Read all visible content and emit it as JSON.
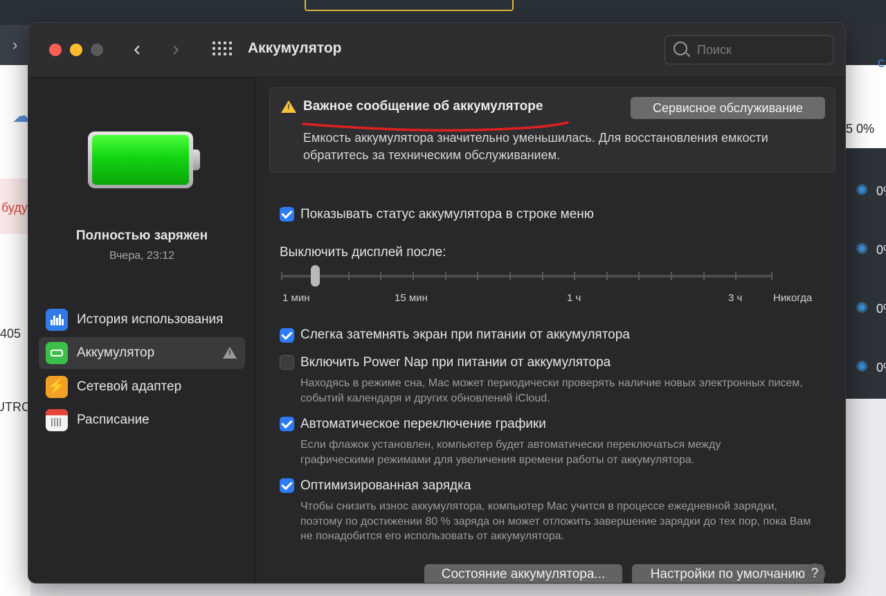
{
  "window": {
    "title": "Аккумулятор",
    "search_placeholder": "Поиск"
  },
  "sidebar": {
    "status_title": "Полностью заряжен",
    "status_time": "Вчера, 23:12",
    "items": [
      {
        "label": "История использования",
        "icon": "bar-chart-icon"
      },
      {
        "label": "Аккумулятор",
        "icon": "battery-icon",
        "active": true,
        "warning": true
      },
      {
        "label": "Сетевой адаптер",
        "icon": "lightning-icon"
      },
      {
        "label": "Расписание",
        "icon": "calendar-icon"
      }
    ]
  },
  "alert": {
    "title": "Важное сообщение об аккумуляторе",
    "text": "Емкость аккумулятора значительно уменьшилась. Для восстановления емкости обратитесь за техническим обслуживанием.",
    "service_button": "Сервисное обслуживание",
    "underline_color": "#e02020"
  },
  "options": {
    "show_status": {
      "label": "Показывать статус аккумулятора в строке меню",
      "checked": true
    },
    "dim_screen": {
      "label": "Слегка затемнять экран при питании от аккумулятора",
      "checked": true
    },
    "power_nap": {
      "label": "Включить Power Nap при питании от аккумулятора",
      "checked": false,
      "description": "Находясь в режиме сна, Mac может периодически проверять наличие новых электронных писем, событий календаря и других обновлений iCloud."
    },
    "auto_graphics": {
      "label": "Автоматическое переключение графики",
      "checked": true,
      "description": "Если флажок установлен, компьютер будет автоматически переключаться между графическими режимами для увеличения времени работы от аккумулятора."
    },
    "optimized_charging": {
      "label": "Оптимизированная зарядка",
      "checked": true,
      "description": "Чтобы снизить износ аккумулятора, компьютер Mac учится в процессе ежедневной зарядки, поэтому по достижении 80 % заряда он может отложить завершение зарядки до тех пор, пока Вам не понадобится его использовать от аккумулятора."
    }
  },
  "display_off": {
    "label": "Выключить дисплей после:",
    "value_label": "2 мин",
    "scale_labels": [
      "1 мин",
      "15 мин",
      "1 ч",
      "3 ч",
      "Никогда"
    ]
  },
  "buttons": {
    "battery_health": "Состояние аккумулятора...",
    "defaults": "Настройки по умолчанию",
    "help": "?"
  },
  "background": {
    "text_red": "буду",
    "text_405": "405",
    "text_utrc": "UTRC",
    "pct_top": "5  0%",
    "pct": "0%"
  },
  "colors": {
    "accent": "#2d7cf6",
    "battery_green": "#13d413",
    "warning_yellow": "#f6c43a"
  }
}
